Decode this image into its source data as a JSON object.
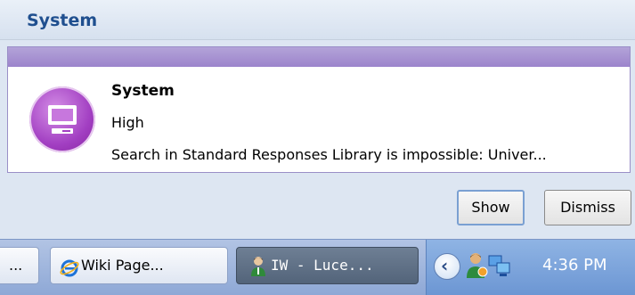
{
  "notification": {
    "header_title": "System",
    "alert": {
      "title": "System",
      "priority": "High",
      "message": "Search in Standard Responses Library is impossible: Univer...",
      "icon": "computer-icon",
      "accent_color": "#a23fc2"
    },
    "buttons": {
      "show_label": "Show",
      "dismiss_label": "Dismiss"
    }
  },
  "taskbar": {
    "items": [
      {
        "label": "...",
        "icon": null
      },
      {
        "label": "Wiki Page...",
        "icon": "internet-explorer-icon"
      },
      {
        "label": "IW - Luce...",
        "icon": "user-agent-icon",
        "active": true
      }
    ],
    "tray": {
      "icons": [
        "show-hidden-icons-chevron",
        "user-status-icon",
        "network-icon"
      ],
      "clock": "4:36 PM"
    }
  }
}
